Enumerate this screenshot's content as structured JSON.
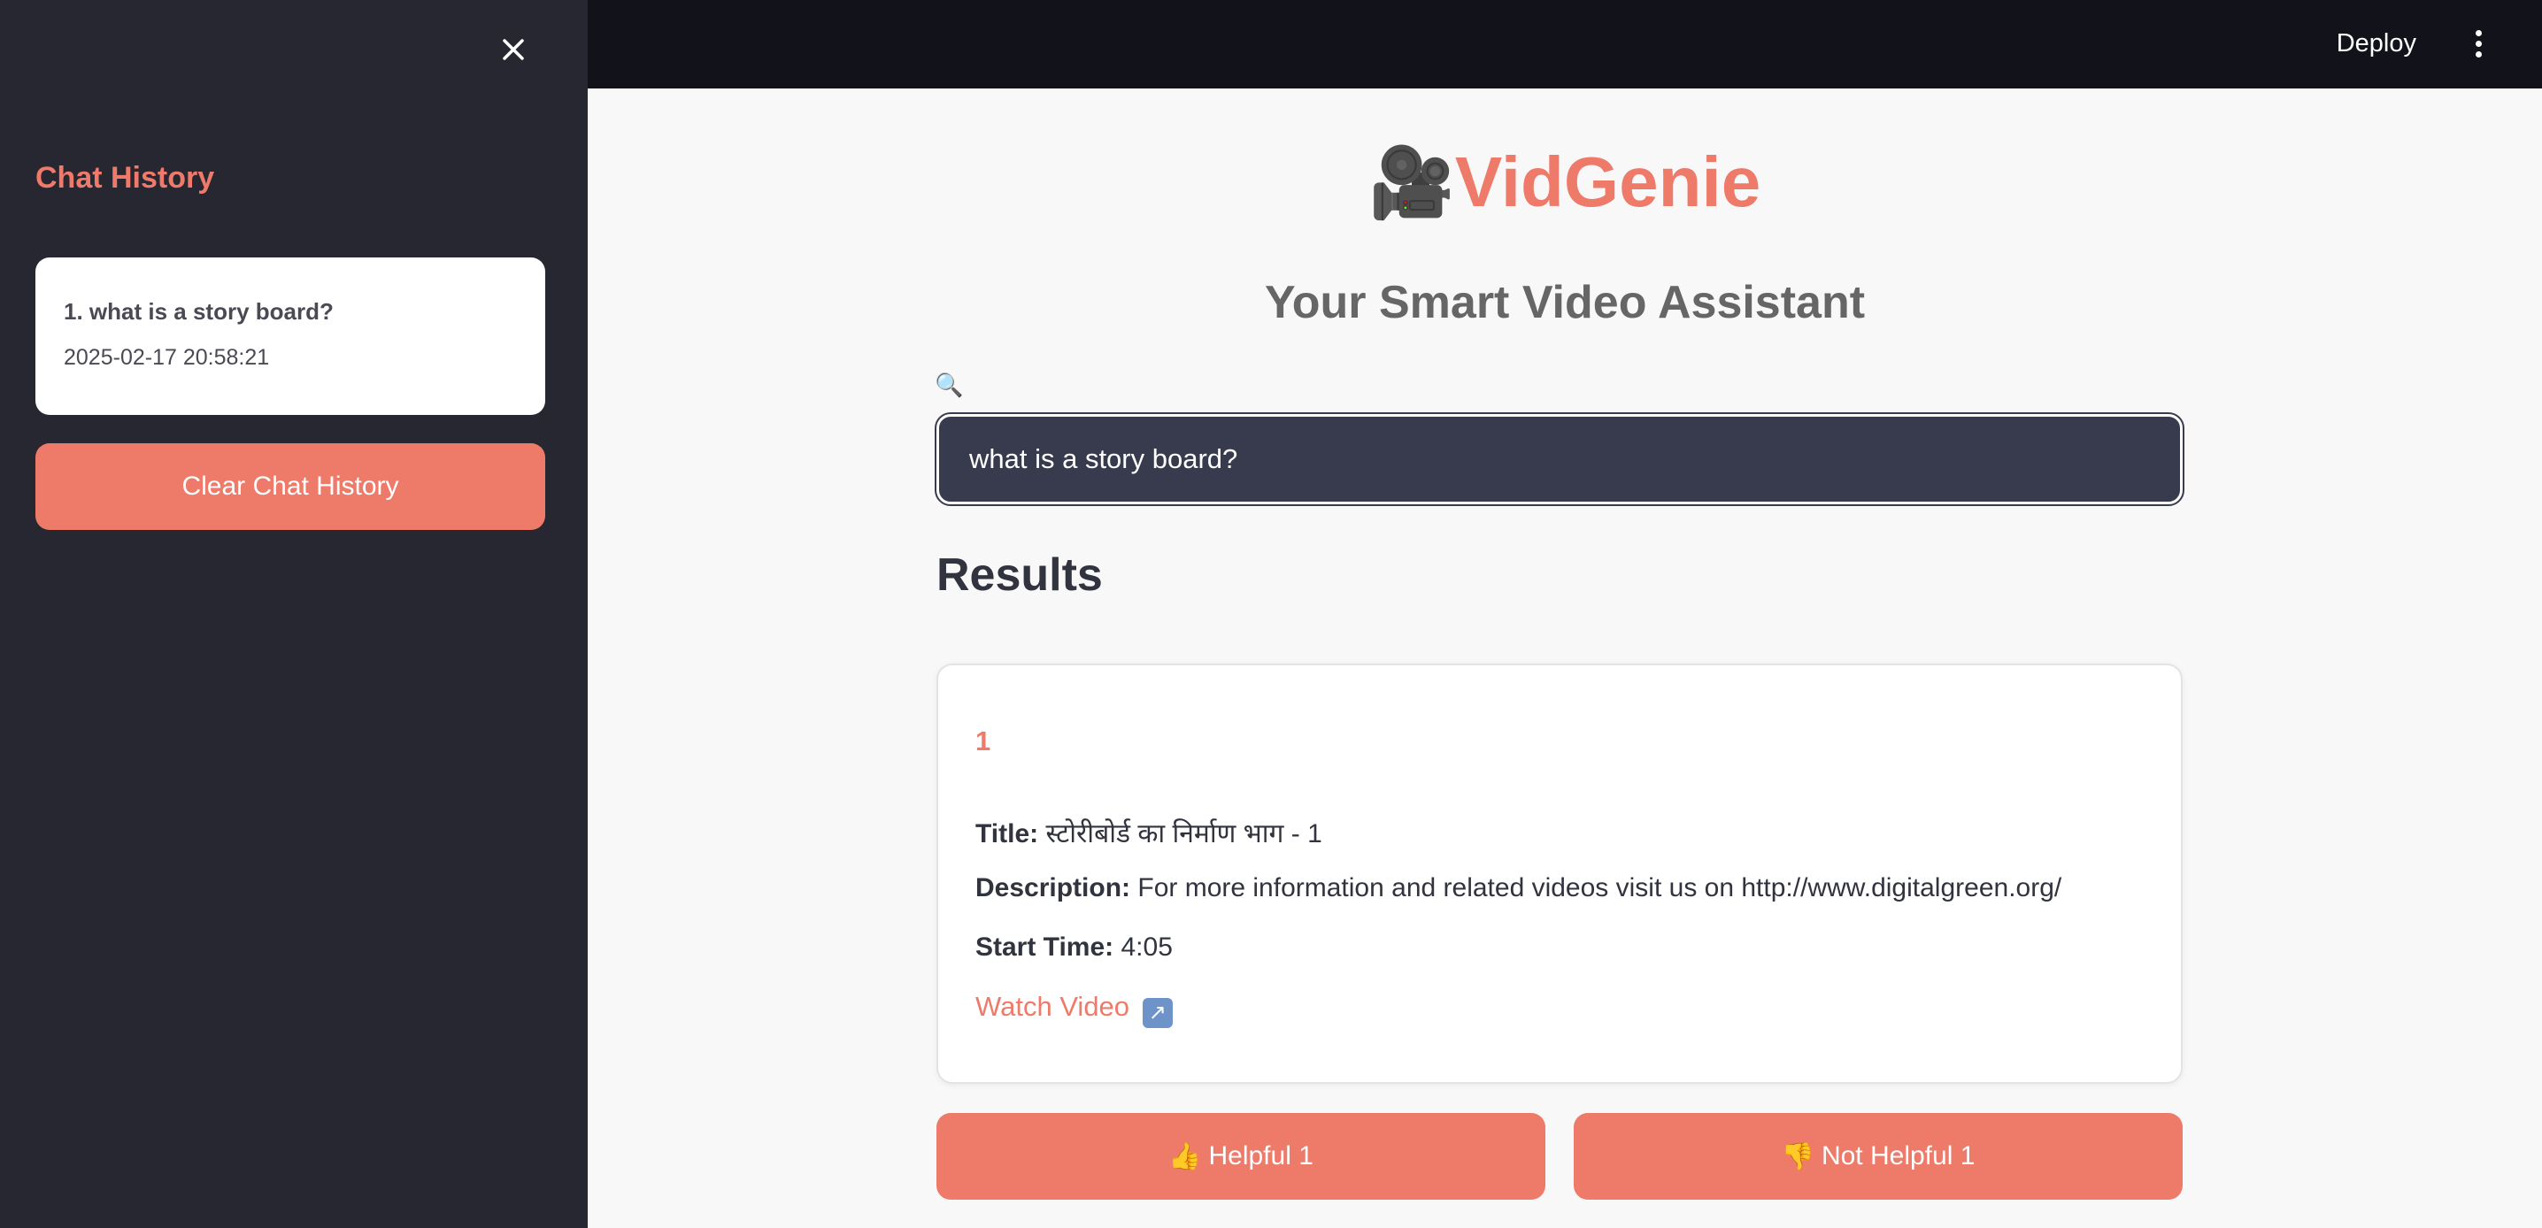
{
  "sidebar": {
    "title": "Chat History",
    "history": [
      {
        "question": "1. what is a story board?",
        "timestamp": "2025-02-17 20:58:21"
      }
    ],
    "clear_label": "Clear Chat History"
  },
  "topbar": {
    "deploy_label": "Deploy"
  },
  "main": {
    "app_icon": "🎥",
    "app_title": "VidGenie",
    "subtitle": "Your Smart Video Assistant",
    "search_icon": "🔍",
    "search_value": "what is a story board?",
    "results_heading": "Results",
    "results": [
      {
        "index": "1",
        "title_label": "Title:",
        "title": "स्टोरीबोर्ड का निर्माण भाग - 1",
        "description_label": "Description:",
        "description": "For more information and related videos visit us on http://www.digitalgreen.org/",
        "start_label": "Start Time:",
        "start_time": "4:05",
        "watch_label": "Watch Video",
        "watch_icon": "↗",
        "helpful_emoji": "👍",
        "helpful_label": "Helpful 1",
        "not_helpful_emoji": "👎",
        "not_helpful_label": "Not Helpful 1"
      }
    ]
  },
  "colors": {
    "accent": "#ee7a6a",
    "sidebar_bg": "#262730",
    "topbar_bg": "#12131a",
    "input_bg": "#383b4e"
  }
}
